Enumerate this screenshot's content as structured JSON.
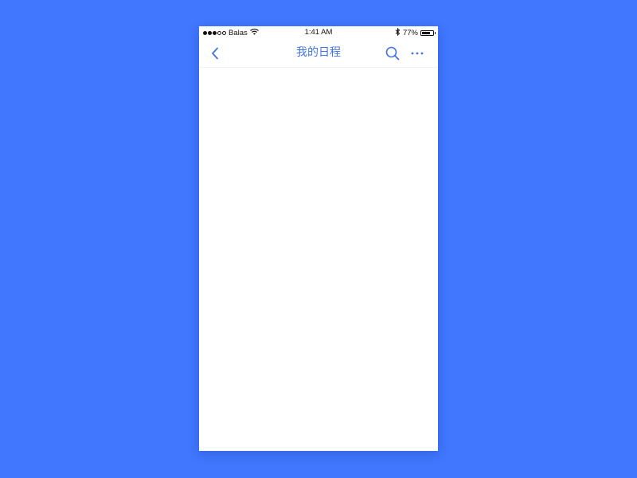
{
  "status_bar": {
    "signal_filled": 3,
    "signal_total": 5,
    "carrier": "Balas",
    "time": "1:41 AM",
    "battery_text": "77%",
    "battery_level": 0.77
  },
  "nav": {
    "title": "我的日程"
  },
  "colors": {
    "background": "#4077fe",
    "accent": "#3f74e6",
    "screen": "#ffffff"
  },
  "icons": [
    "back-chevron-icon",
    "search-icon",
    "more-icon",
    "wifi-icon",
    "bluetooth-icon",
    "battery-icon"
  ]
}
